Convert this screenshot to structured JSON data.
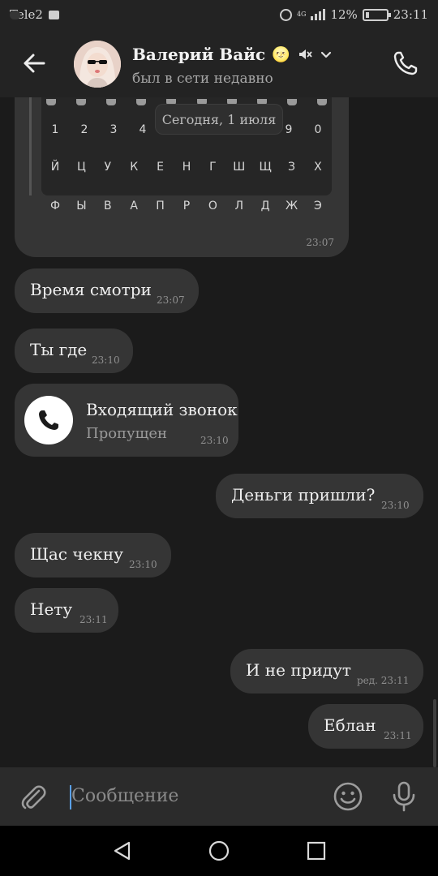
{
  "status_bar": {
    "carrier": "Tele2",
    "network": "4G",
    "battery_percent": "12%",
    "time": "23:11"
  },
  "header": {
    "contact_name": "Валерий Вайс",
    "name_emoji": "🌝",
    "status": "был в сети недавно",
    "icons": [
      "back-arrow-icon",
      "mute-icon",
      "chevron-down-icon",
      "phone-icon"
    ]
  },
  "date_divider": "Сегодня, 1 июля",
  "image_message": {
    "keyboard_rows": [
      [
        "1",
        "2",
        "3",
        "4",
        "5",
        "6",
        "7",
        "8",
        "9",
        "0"
      ],
      [
        "Й",
        "Ц",
        "У",
        "К",
        "Е",
        "Н",
        "Г",
        "Ш",
        "Щ",
        "З",
        "Х"
      ],
      [
        "Ф",
        "Ы",
        "В",
        "А",
        "П",
        "Р",
        "О",
        "Л",
        "Д",
        "Ж",
        "Э"
      ]
    ],
    "time": "23:07"
  },
  "messages": [
    {
      "direction": "in",
      "text": "Время смотри",
      "time": "23:07"
    },
    {
      "direction": "in",
      "text": "Ты где",
      "time": "23:10"
    },
    {
      "direction": "out",
      "text": "Деньги пришли?",
      "time": "23:10"
    },
    {
      "direction": "in",
      "text": "Щас чекну",
      "time": "23:10"
    },
    {
      "direction": "in",
      "text": "Нету",
      "time": "23:11"
    },
    {
      "direction": "out",
      "text": "И не придут",
      "time": "ред. 23:11"
    },
    {
      "direction": "out",
      "text": "Еблан",
      "time": "23:11"
    }
  ],
  "call_message": {
    "title": "Входящий звонок",
    "status": "Пропущен",
    "time": "23:10"
  },
  "input": {
    "placeholder": "Сообщение",
    "icons": [
      "paperclip-icon",
      "emoji-icon",
      "microphone-icon"
    ]
  },
  "colors": {
    "background": "#1b1b1b",
    "header": "#232323",
    "bubble": "#353535",
    "caret": "#5aa0e6"
  }
}
